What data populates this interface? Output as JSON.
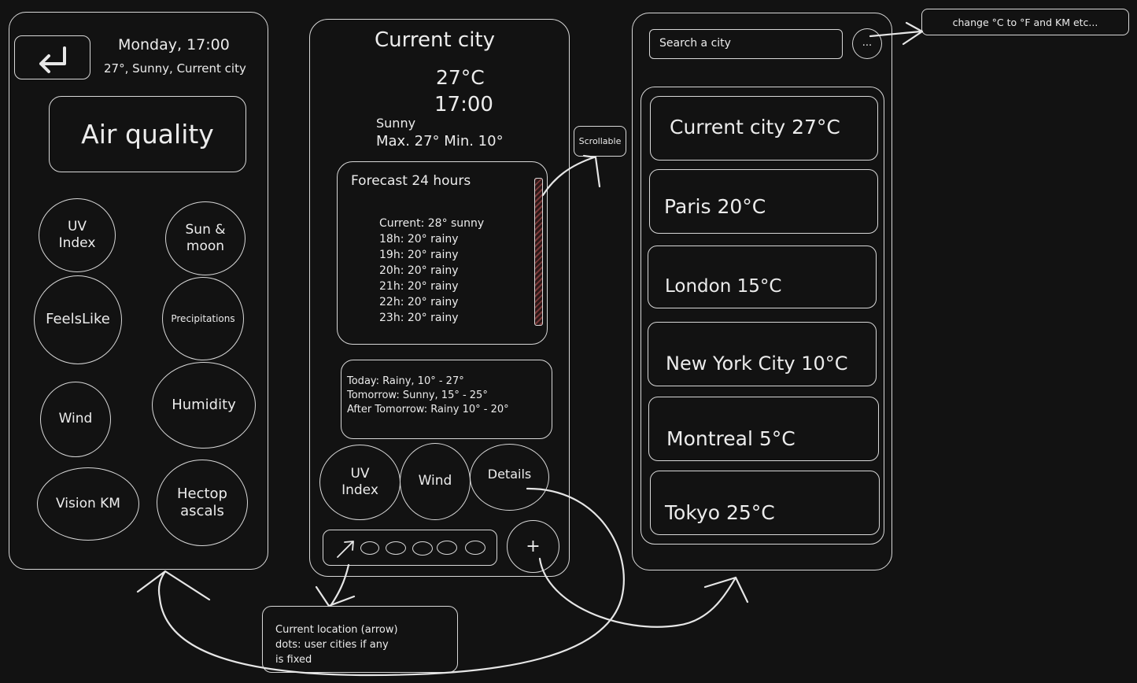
{
  "left": {
    "date_time": "Monday, 17:00",
    "summary": "27°, Sunny, Current city",
    "air_quality": "Air quality",
    "tiles": {
      "uv_index": "UV Index",
      "sun_moon": "Sun & moon",
      "feels_like": "FeelsLike",
      "precipitations": "Precipitations",
      "wind": "Wind",
      "humidity": "Humidity",
      "vision": "Vision KM",
      "hectopascals_1": "Hectop",
      "hectopascals_2": "ascals"
    }
  },
  "center": {
    "city": "Current city",
    "temperature": "27°C",
    "time": "17:00",
    "condition": "Sunny",
    "min_max": "Max. 27° Min. 10°",
    "forecast_title": "Forecast 24 hours",
    "forecast_rows": [
      "Current: 28° sunny",
      "18h: 20° rainy",
      "19h: 20° rainy",
      "20h: 20° rainy",
      "21h: 20° rainy",
      "22h: 20° rainy",
      "23h: 20° rainy"
    ],
    "daily_rows": [
      "Today: Rainy, 10° - 27°",
      "Tomorrow: Sunny, 15° - 25°",
      "After Tomorrow: Rainy 10° - 20°"
    ],
    "buttons": {
      "uv_1": "UV",
      "uv_2": "Index",
      "wind": "Wind",
      "details": "Details"
    },
    "add_label": "+"
  },
  "right": {
    "search_placeholder": "Search a city",
    "menu_label": "...",
    "cities": [
      "Current city 27°C",
      "Paris 20°C",
      "London 15°C",
      "New York City 10°C",
      "Montreal 5°C",
      "Tokyo 25°C"
    ]
  },
  "annotations": {
    "scrollable": "Scrollable",
    "units": "change °C to °F and KM etc...",
    "location_1": "Current location (arrow)",
    "location_2": "dots: user cities if any",
    "location_3": "is fixed"
  },
  "colors": {
    "background": "#121212",
    "stroke": "#d8d8d8",
    "scrollbar_fill": "#7a3a3a"
  }
}
